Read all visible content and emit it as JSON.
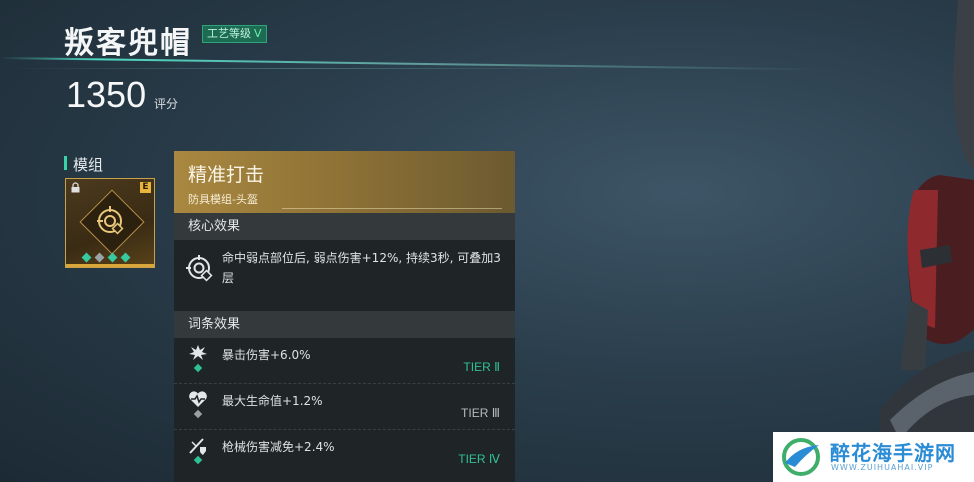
{
  "item": {
    "title": "叛客兜帽",
    "craft_label": "工艺等级",
    "craft_level": "V",
    "score": "1350",
    "score_unit": "评分"
  },
  "module_section": {
    "label": "模组",
    "grade": "E",
    "pips": [
      "green",
      "grey",
      "green",
      "green"
    ]
  },
  "panel": {
    "name": "精准打击",
    "subtitle": "防具模组-头盔",
    "core_header": "核心效果",
    "core_text": "命中弱点部位后, 弱点伤害+12%, 持续3秒, 可叠加3层",
    "affix_header": "词条效果",
    "affixes": [
      {
        "text": "暴击伤害+6.0%",
        "tier": "TIER Ⅱ",
        "icon": "crit-burst-icon",
        "color": "green"
      },
      {
        "text": "最大生命值+1.2%",
        "tier": "TIER Ⅲ",
        "icon": "heart-pulse-icon",
        "color": "grey"
      },
      {
        "text": "枪械伤害减免+2.4%",
        "tier": "TIER Ⅳ",
        "icon": "gun-shield-icon",
        "color": "green"
      }
    ]
  },
  "watermark": {
    "text": "醉花海手游网",
    "sub": "WWW.ZUIHUAHAI.VIP"
  },
  "colors": {
    "accent": "#38d3a8",
    "gold": "#a98840",
    "tier_green": "#2fc196"
  }
}
